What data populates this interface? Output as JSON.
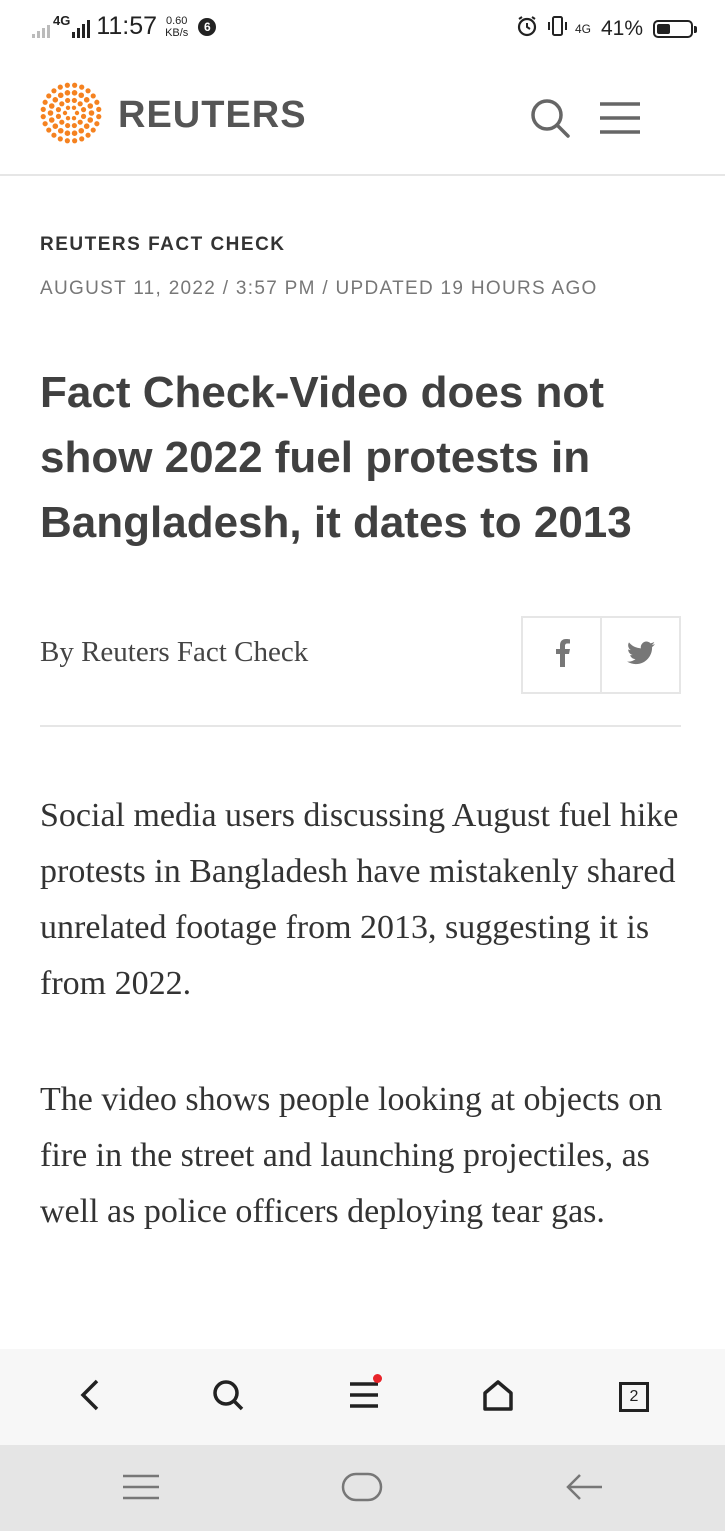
{
  "status_bar": {
    "network": "4G",
    "time": "11:57",
    "speed_value": "0.60",
    "speed_unit": "KB/s",
    "notification_badge": "6",
    "network2": "4G",
    "battery_percent_text": "41%",
    "battery_level": 0.41,
    "icons": [
      "signal-icon",
      "alarm-icon",
      "vibrate-icon",
      "battery-icon"
    ]
  },
  "header": {
    "brand": "REUTERS",
    "brand_color": "#f58220",
    "icons": [
      "reuters-logo-icon",
      "search-icon",
      "hamburger-menu-icon"
    ]
  },
  "article": {
    "kicker": "REUTERS FACT CHECK",
    "dateline": "AUGUST 11, 2022 / 3:57 PM / UPDATED 19 HOURS AGO",
    "headline": "Fact Check-Video does not show 2022 fuel protests in Bangladesh, it dates to 2013",
    "byline": "By Reuters Fact Check",
    "share": [
      {
        "label": "f",
        "icon": "facebook-icon"
      },
      {
        "label": "",
        "icon": "twitter-icon"
      }
    ],
    "paragraphs": [
      "Social media users discussing August fuel hike protests in Bangladesh have mistakenly shared unrelated footage from 2013, suggesting it is from 2022.",
      "The video shows people looking at objects on fire in the street and launching projectiles, as well as police officers deploying tear gas."
    ]
  },
  "browser_toolbar": {
    "items": [
      "back-icon",
      "search-icon",
      "menu-icon",
      "home-icon",
      "tabs-icon"
    ],
    "tab_count": "2",
    "notification_dot_color": "#e8242a"
  },
  "system_nav": {
    "items": [
      "recents-icon",
      "home-icon",
      "back-arrow-icon"
    ]
  }
}
